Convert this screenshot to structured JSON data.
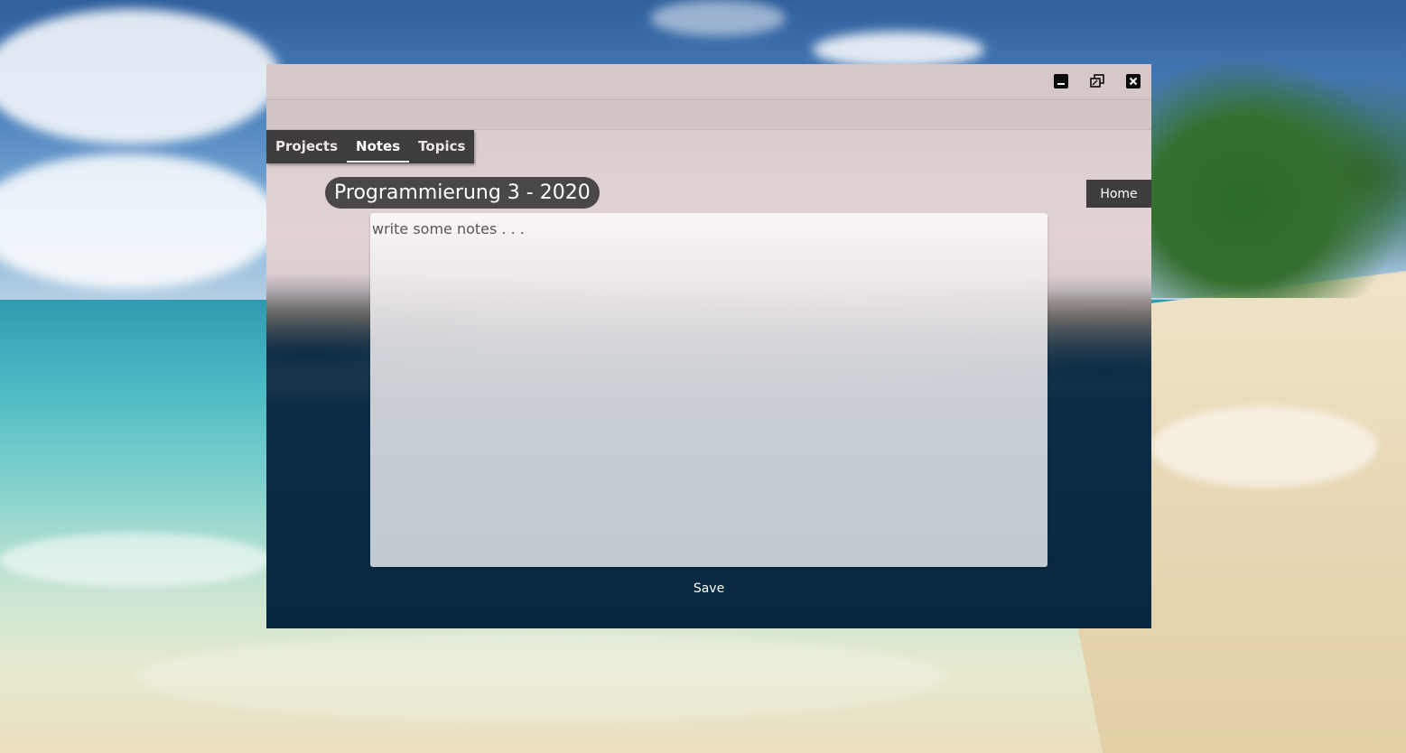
{
  "window": {
    "controls": {
      "minimize_icon": "minimize-icon",
      "restore_icon": "restore-icon",
      "close_icon": "close-icon"
    }
  },
  "tabs": [
    {
      "label": "Projects",
      "active": false
    },
    {
      "label": "Notes",
      "active": true
    },
    {
      "label": "Topics",
      "active": false
    }
  ],
  "main": {
    "title": "Programmierung 3 - 2020",
    "home_label": "Home",
    "notes_placeholder": "write some notes . . .",
    "notes_value": "",
    "save_label": "Save"
  },
  "colors": {
    "tab_bar": "#3f3c3d",
    "title_pill": "#4a4748",
    "window_dark": "#0a2b45"
  }
}
